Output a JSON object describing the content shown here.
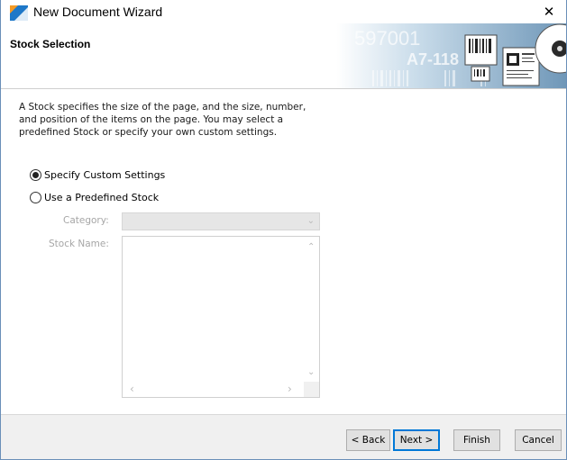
{
  "window": {
    "title": "New Document Wizard",
    "close_glyph": "✕"
  },
  "header": {
    "title": "Stock Selection",
    "banner_text_1": "597001",
    "banner_text_2": "A7-118"
  },
  "body": {
    "description_lines": [
      "A Stock specifies the size of the page, and the size, number,",
      "and position of the items on the page. You may select a",
      "predefined Stock or specify your own custom settings."
    ],
    "option_custom": "Specify Custom Settings",
    "option_predefined": "Use a Predefined Stock",
    "selected_option": "custom",
    "category_label": "Category:",
    "category_value": "",
    "stock_name_label": "Stock Name:"
  },
  "footer": {
    "back_label": "< Back",
    "next_label": "Next >",
    "finish_label": "Finish",
    "cancel_label": "Cancel"
  },
  "colors": {
    "accent": "#0078d7",
    "icon_blue": "#1e78c8",
    "icon_orange": "#f59a23"
  }
}
